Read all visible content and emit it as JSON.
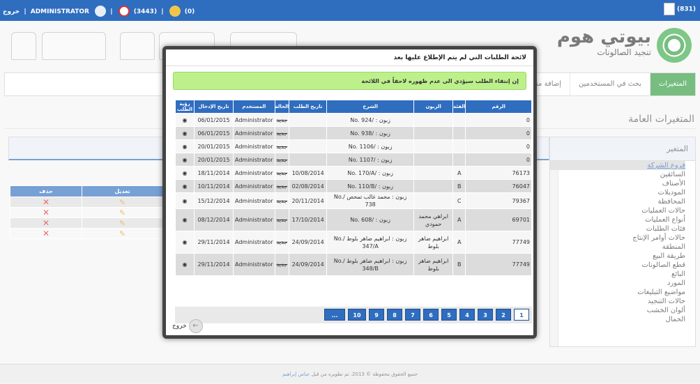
{
  "topbar": {
    "logout": "خروج",
    "user": "ADMINISTRATOR",
    "alarms": "(3443)",
    "messages": "(0)",
    "calendar_count": "(831)"
  },
  "brand": {
    "name": "بيوتي هوم",
    "tagline": "تنجيد الصالونات"
  },
  "nav": {
    "items": [
      {
        "label": "المتغيرات",
        "active": true
      },
      {
        "label": "بحث في المستخدمين",
        "active": false
      },
      {
        "label": "إضافة مس",
        "active": false
      }
    ]
  },
  "page": {
    "title": "المتغيرات العامة"
  },
  "variables": {
    "header": "المتغير",
    "items": [
      "فروع الشركة",
      "السائقين",
      "الأصناف",
      "الموديلات",
      "المحافظة",
      "حالات العمليات",
      "أنواع العمليات",
      "فئات الطلبات",
      "حالات أوامر الإنتاج",
      "المنطقة",
      "طريقة البيع",
      "قطع الصالونات",
      "البائع",
      "المورد",
      "مواضيع التبليغات",
      "حالات التنجيد",
      "ألوان الخشب",
      "الحمال"
    ]
  },
  "back_table": {
    "headers": [
      "حذف",
      "تعديل"
    ]
  },
  "modal": {
    "title": "لائحة الطلبات التي لم يتم الإطلاع عليها بعد",
    "notice": "إن إنتقاء الطلب سيؤدي الى عدم ظهوره لاحقاً في اللائحة",
    "headers": [
      "الرقم",
      "الفئة",
      "الزبون",
      "الشرح",
      "تاريخ الطلب",
      "الحالة",
      "المستخدم",
      "تاريخ الإدخال",
      "رؤية الطلب"
    ],
    "rows": [
      {
        "num": "0",
        "cat": "",
        "cust": "",
        "desc": "زبون : /No. 924",
        "date": "",
        "status": "جديد",
        "user": "Administrator",
        "edate": "06/01/2015",
        "tall": false
      },
      {
        "num": "0",
        "cat": "",
        "cust": "",
        "desc": "زبون : /No. 938",
        "date": "",
        "status": "جديد",
        "user": "Administrator",
        "edate": "06/01/2015",
        "tall": false
      },
      {
        "num": "0",
        "cat": "",
        "cust": "",
        "desc": "زبون : /No. 1106",
        "date": "",
        "status": "جديد",
        "user": "Administrator",
        "edate": "20/01/2015",
        "tall": false
      },
      {
        "num": "0",
        "cat": "",
        "cust": "",
        "desc": "زبون : /No. 1107",
        "date": "",
        "status": "جديد",
        "user": "Administrator",
        "edate": "20/01/2015",
        "tall": false
      },
      {
        "num": "76173",
        "cat": "A",
        "cust": "",
        "desc": "زبون : /No. 170/A",
        "date": "10/08/2014",
        "status": "جديد",
        "user": "Administrator",
        "edate": "18/11/2014",
        "tall": false
      },
      {
        "num": "76047",
        "cat": "B",
        "cust": "",
        "desc": "زبون : /No. 110/B",
        "date": "02/08/2014",
        "status": "جديد",
        "user": "Administrator",
        "edate": "10/11/2014",
        "tall": false
      },
      {
        "num": "79367",
        "cat": "C",
        "cust": "",
        "desc": "زبون : محمد غالب تمحص /No. 738",
        "date": "20/11/2014",
        "status": "جديد",
        "user": "Administrator",
        "edate": "15/12/2014",
        "tall": false
      },
      {
        "num": "69701",
        "cat": "A",
        "cust": "ابراهي محمد حمودي",
        "desc": "زبون : /No. 608",
        "date": "17/10/2014",
        "status": "جديد",
        "user": "Administrator",
        "edate": "08/12/2014",
        "tall": true
      },
      {
        "num": "77749",
        "cat": "A",
        "cust": "ابراهيم ضاهر بلوط",
        "desc": "زبون : ابراهيم ضاهر بلوط /No. 347/A",
        "date": "24/09/2014",
        "status": "جديد",
        "user": "Administrator",
        "edate": "29/11/2014",
        "tall": true
      },
      {
        "num": "77749",
        "cat": "B",
        "cust": "ابراهيم ضاهر بلوط",
        "desc": "زبون : ابراهيم ضاهر بلوط /No. 348/B",
        "date": "24/09/2014",
        "status": "جديد",
        "user": "Administrator",
        "edate": "29/11/2014",
        "tall": true
      }
    ],
    "pages": [
      "1",
      "2",
      "3",
      "4",
      "5",
      "6",
      "7",
      "8",
      "9",
      "10",
      "..."
    ],
    "current_page": "1",
    "exit": "خروج"
  },
  "footer": {
    "text": "جميع الحقوق محفوظة © 2013. تم تطويره من قبل",
    "author": "عباس إبراهيم"
  }
}
